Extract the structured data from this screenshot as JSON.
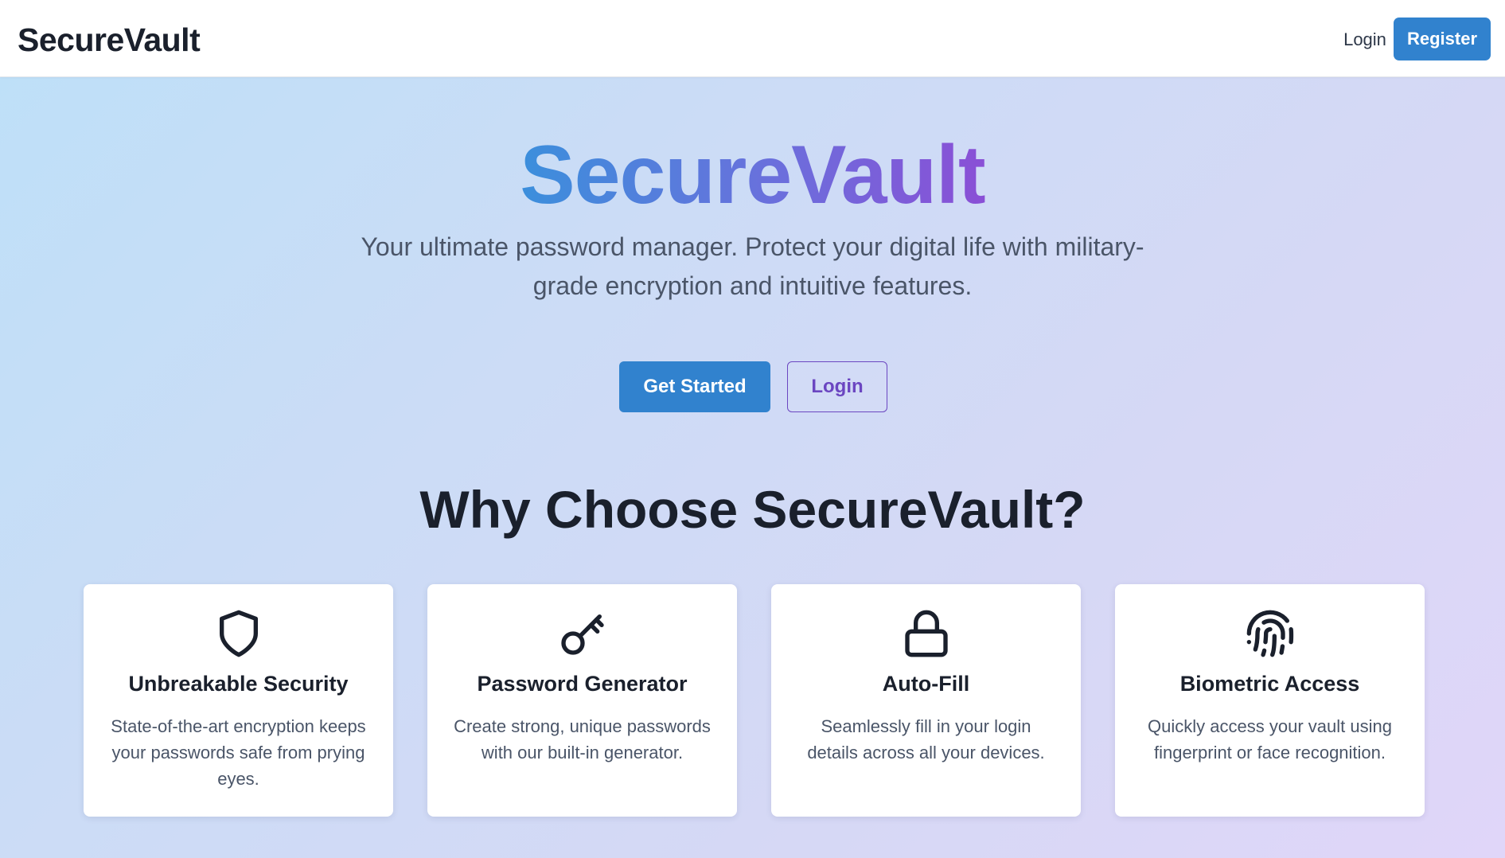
{
  "nav": {
    "brand": "SecureVault",
    "login_label": "Login",
    "register_label": "Register"
  },
  "hero": {
    "title": "SecureVault",
    "subtitle": "Your ultimate password manager. Protect your digital life with military-grade encryption and intuitive features.",
    "get_started_label": "Get Started",
    "login_label": "Login"
  },
  "features": {
    "heading": "Why Choose SecureVault?",
    "items": [
      {
        "icon": "shield-icon",
        "title": "Unbreakable Security",
        "description": "State-of-the-art encryption keeps your passwords safe from prying eyes."
      },
      {
        "icon": "key-icon",
        "title": "Password Generator",
        "description": "Create strong, unique passwords with our built-in generator."
      },
      {
        "icon": "lock-icon",
        "title": "Auto-Fill",
        "description": "Seamlessly fill in your login details across all your devices."
      },
      {
        "icon": "fingerprint-icon",
        "title": "Biometric Access",
        "description": "Quickly access your vault using fingerprint or face recognition."
      }
    ]
  },
  "colors": {
    "primary": "#3182ce",
    "accent_purple": "#6b46c1",
    "text_dark": "#1a202c",
    "text_muted": "#4a5568"
  }
}
